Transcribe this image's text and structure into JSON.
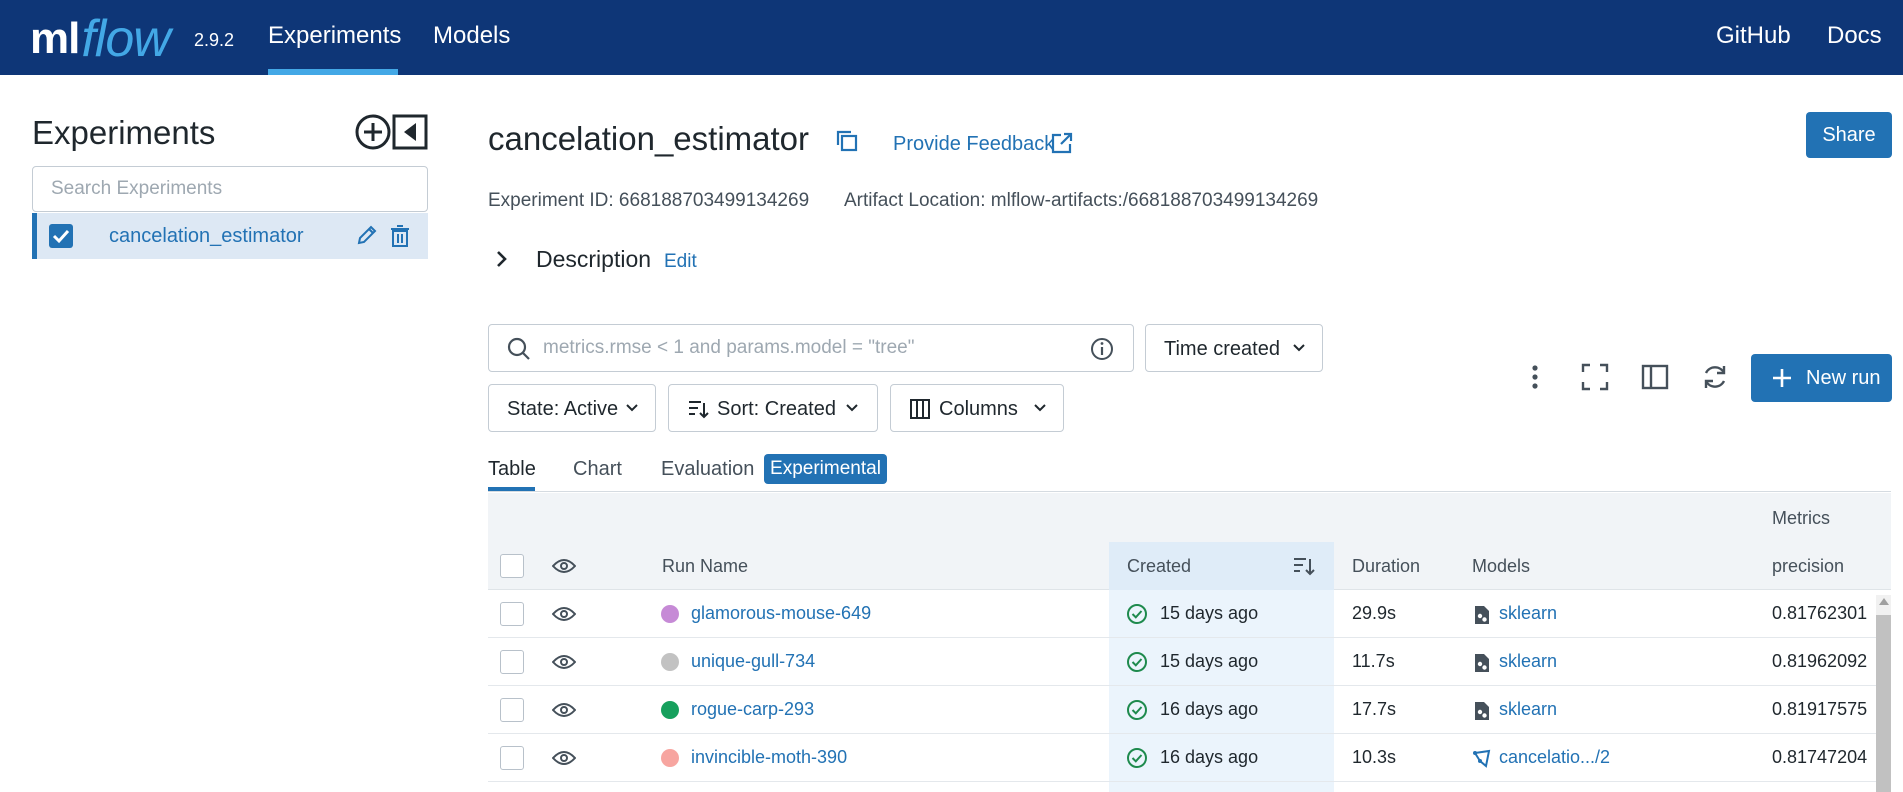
{
  "nav": {
    "logo_ml": "ml",
    "logo_flow": "flow",
    "version": "2.9.2",
    "links": [
      "Experiments",
      "Models"
    ],
    "right_links": [
      "GitHub",
      "Docs"
    ]
  },
  "sidebar": {
    "title": "Experiments",
    "search_placeholder": "Search Experiments",
    "experiments": [
      {
        "name": "cancelation_estimator",
        "checked": true
      }
    ]
  },
  "header": {
    "title": "cancelation_estimator",
    "feedback": "Provide Feedback",
    "share": "Share",
    "experiment_id": "Experiment ID: 668188703499134269",
    "artifact_location": "Artifact Location: mlflow-artifacts:/668188703499134269",
    "description": "Description",
    "description_edit": "Edit"
  },
  "filters": {
    "search_placeholder": "metrics.rmse < 1 and params.model = \"tree\"",
    "time_created": "Time created",
    "state": "State: Active",
    "sort": "Sort: Created",
    "columns": "Columns",
    "new_run": "New run"
  },
  "tabs": {
    "table": "Table",
    "chart": "Chart",
    "evaluation": "Evaluation",
    "experimental": "Experimental"
  },
  "table": {
    "group_header": "Metrics",
    "columns": {
      "run_name": "Run Name",
      "created": "Created",
      "duration": "Duration",
      "models": "Models",
      "precision": "precision"
    },
    "rows": [
      {
        "run_name": "glamorous-mouse-649",
        "color": "#c68ad6",
        "created": "15 days ago",
        "duration": "29.9s",
        "model": "sklearn",
        "model_kind": "sklearn",
        "precision": "0.81762301"
      },
      {
        "run_name": "unique-gull-734",
        "color": "#c2c2c2",
        "created": "15 days ago",
        "duration": "11.7s",
        "model": "sklearn",
        "model_kind": "sklearn",
        "precision": "0.81962092"
      },
      {
        "run_name": "rogue-carp-293",
        "color": "#17a05d",
        "created": "16 days ago",
        "duration": "17.7s",
        "model": "sklearn",
        "model_kind": "sklearn",
        "precision": "0.81917575"
      },
      {
        "run_name": "invincible-moth-390",
        "color": "#f7a5a0",
        "created": "16 days ago",
        "duration": "10.3s",
        "model": "cancelatio.../2",
        "model_kind": "registered",
        "precision": "0.81747204"
      }
    ]
  },
  "colors": {
    "nav_bg": "#0e3677",
    "accent": "#2272b4",
    "nav_highlight": "#43a8e6",
    "success": "#1e8a4d"
  }
}
